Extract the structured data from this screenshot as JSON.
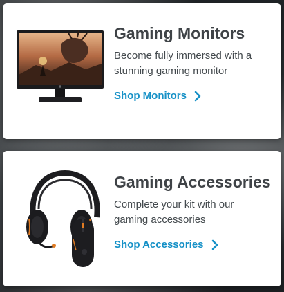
{
  "cards": [
    {
      "title": "Gaming Monitors",
      "description": "Become fully immersed with a stunning gaming monitor",
      "link_label": "Shop Monitors",
      "image_icon": "gaming-monitor-icon"
    },
    {
      "title": "Gaming Accessories",
      "description": "Complete your kit with our gaming accessories",
      "link_label": "Shop Accessories",
      "image_icon": "gaming-headset-mouse-icon"
    }
  ],
  "colors": {
    "accent": "#1691c7",
    "title": "#3f4347",
    "text": "#444a4e",
    "card": "#ffffff"
  }
}
